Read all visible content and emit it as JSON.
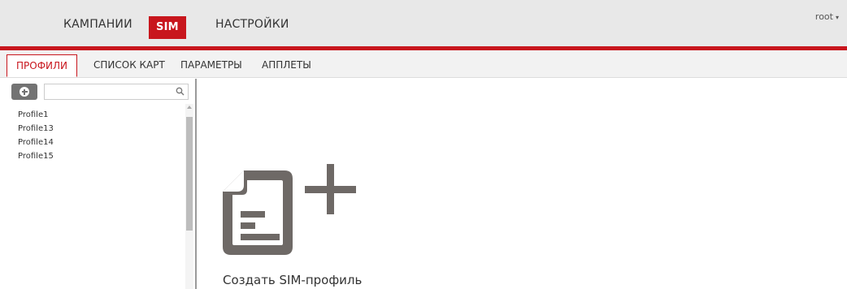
{
  "topnav": {
    "items": [
      {
        "label": "КАМПАНИИ",
        "active": false
      },
      {
        "label": "SIM",
        "active": true
      },
      {
        "label": "НАСТРОЙКИ",
        "active": false
      }
    ],
    "user": "root",
    "user_caret": "▾"
  },
  "subtabs": [
    {
      "label": "ПРОФИЛИ",
      "active": true
    },
    {
      "label": "СПИСОК КАРТ",
      "active": false
    },
    {
      "label": "ПАРАМЕТРЫ",
      "active": false
    },
    {
      "label": "АППЛЕТЫ",
      "active": false
    }
  ],
  "sidebar": {
    "add_icon": "plus-circle-icon",
    "search": {
      "value": "",
      "placeholder": "",
      "icon": "search-icon"
    },
    "profiles": [
      "Profile1",
      "Profile13",
      "Profile14",
      "Profile15"
    ]
  },
  "main": {
    "create_label": "Создать SIM-профиль",
    "create_icon": "new-document-icon"
  },
  "colors": {
    "accent": "#c8161d",
    "header_bg": "#e8e8e8",
    "icon_gray": "#6e6966"
  }
}
